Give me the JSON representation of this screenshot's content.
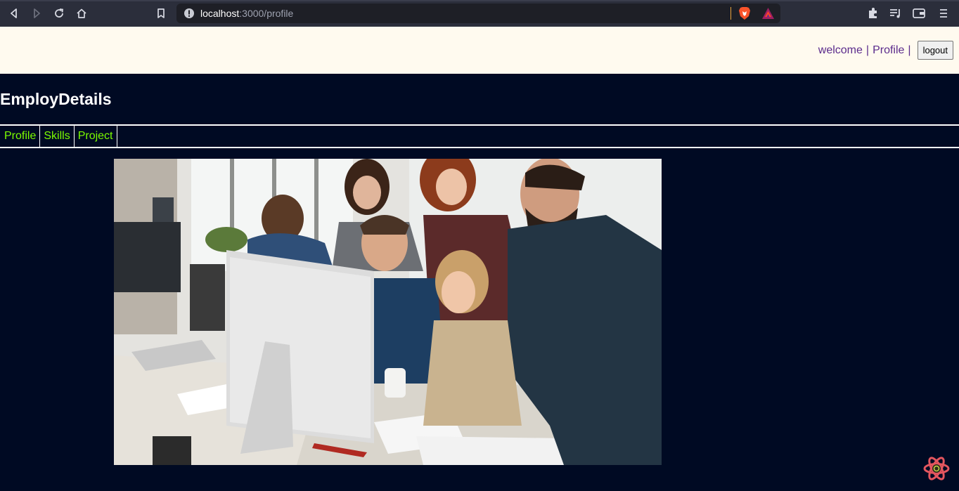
{
  "browser": {
    "url_host": "localhost",
    "url_path": ":3000/profile"
  },
  "header": {
    "welcome_label": "welcome",
    "separator": "|",
    "profile_label": "Profile",
    "logout_label": "logout"
  },
  "page": {
    "title": "EmployDetails"
  },
  "subnav": {
    "items": [
      {
        "label": "Profile"
      },
      {
        "label": "Skills"
      },
      {
        "label": "Project"
      }
    ]
  },
  "colors": {
    "page_bg": "#000a23",
    "header_bg": "#fffaef",
    "link_color": "#5b2b8c",
    "subnav_text": "#7cfc00"
  },
  "icons": {
    "back": "back-arrow-icon",
    "forward": "forward-arrow-icon",
    "reload": "reload-icon",
    "home": "home-icon",
    "bookmark": "bookmark-icon",
    "site_info": "info-icon",
    "brave": "brave-lion-icon",
    "rewards": "bat-rewards-icon",
    "extensions": "puzzle-icon",
    "playlist": "playlist-icon",
    "wallet": "wallet-icon",
    "menu": "hamburger-menu-icon",
    "react": "react-devtools-icon"
  }
}
